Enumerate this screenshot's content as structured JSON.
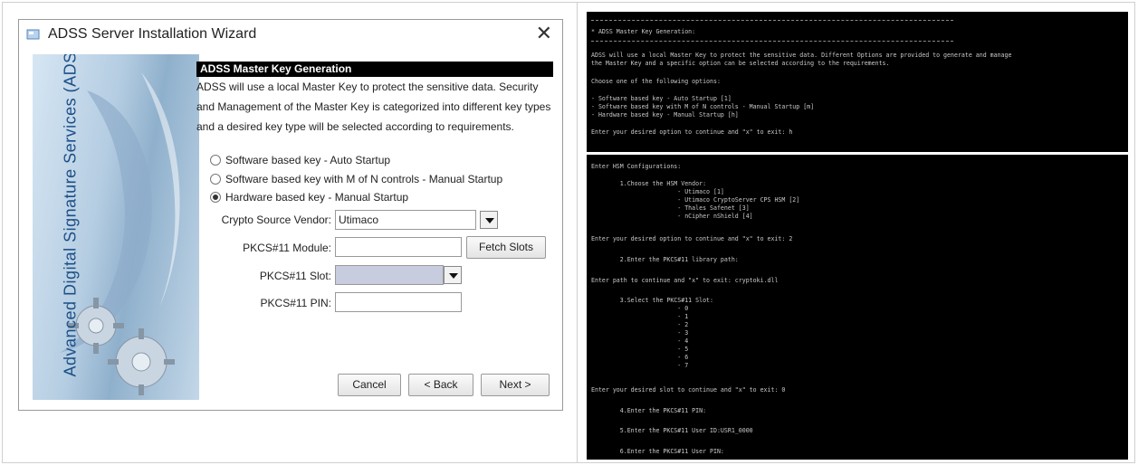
{
  "wizard": {
    "title": "ADSS Server Installation Wizard",
    "banner_text": "Advanced Digital Signature Services (ADSS)",
    "section_header": "ADSS Master Key Generation",
    "description": [
      "ADSS will use a local Master Key to protect the sensitive data. Security",
      "and Management of the Master Key is categorized into different key types",
      "and a desired key type will be selected according to requirements."
    ],
    "options": [
      {
        "label": "Software based key - Auto Startup",
        "selected": false
      },
      {
        "label": "Software based key with M of N controls - Manual Startup",
        "selected": false
      },
      {
        "label": "Hardware based key - Manual Startup",
        "selected": true
      }
    ],
    "vendor_label": "Crypto Source Vendor:",
    "vendor_value": "Utimaco",
    "module_label": "PKCS#11 Module:",
    "module_value": "",
    "fetch_slots": "Fetch Slots",
    "slot_label": "PKCS#11 Slot:",
    "slot_value": "",
    "pin_label": "PKCS#11 PIN:",
    "pin_value": "",
    "cancel": "Cancel",
    "back": "< Back",
    "next": "Next >"
  },
  "console1": {
    "lines": [
      "* ADSS Master Key Generation:",
      "ADSS will use a local Master Key to protect the sensitive data. Different Options are provided to generate and manage",
      "the Master Key and a specific option can be selected according to the requirements.",
      "Choose one of the following options:",
      "- Software based key - Auto Startup [1]",
      "- Software based key with M of N controls - Manual Startup [m]",
      "- Hardware based key - Manual Startup [h]",
      "Enter your desired option to continue and \"x\" to exit: h"
    ]
  },
  "console2": {
    "lines": [
      "Enter HSM Configurations:",
      "        1.Choose the HSM Vendor:",
      "                        - Utimaco [1]",
      "                        - Utimaco CryptoServer CPS HSM [2]",
      "                        - Thales Safenet [3]",
      "                        - nCipher nShield [4]",
      "Enter your desired option to continue and \"x\" to exit: 2",
      "        2.Enter the PKCS#11 library path:",
      "Enter path to continue and \"x\" to exit: cryptoki.dll",
      "        3.Select the PKCS#11 Slot:",
      "                        - 0",
      "                        - 1",
      "                        - 2",
      "                        - 3",
      "                        - 4",
      "                        - 5",
      "                        - 6",
      "                        - 7",
      "Enter your desired slot to continue and \"x\" to exit: 0",
      "        4.Enter the PKCS#11 PIN:",
      "        5.Enter the PKCS#11 User ID:USR1_0000",
      "        6.Enter the PKCS#11 User PIN:"
    ]
  }
}
